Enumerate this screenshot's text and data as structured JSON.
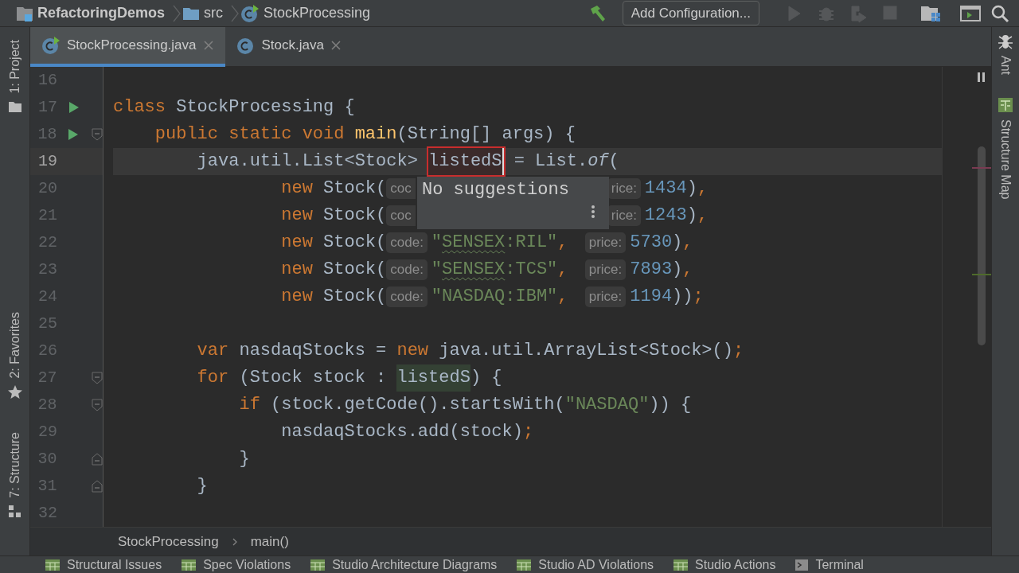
{
  "breadcrumb": [
    {
      "label": "RefactoringDemos",
      "kind": "project"
    },
    {
      "label": "src",
      "kind": "folder"
    },
    {
      "label": "StockProcessing",
      "kind": "class"
    }
  ],
  "toolbar": {
    "config_button": "Add Configuration...",
    "actions": [
      {
        "kind": "run",
        "disabled": true
      },
      {
        "kind": "debug",
        "disabled": true
      },
      {
        "kind": "coverage",
        "disabled": true
      },
      {
        "kind": "stop",
        "disabled": true
      }
    ]
  },
  "left_strip": [
    {
      "label": "1: Project",
      "kind": "project"
    },
    {
      "label": "2: Favorites",
      "kind": "favorites"
    },
    {
      "label": "7: Structure",
      "kind": "structure"
    }
  ],
  "right_strip": [
    {
      "label": "Ant",
      "kind": "ant"
    },
    {
      "label": "Structure Map",
      "kind": "map"
    }
  ],
  "tabs": [
    {
      "label": "StockProcessing.java",
      "selected": true,
      "kind": "runnable"
    },
    {
      "label": "Stock.java",
      "selected": false,
      "kind": "class"
    }
  ],
  "lines": [
    {
      "number": "16",
      "current": false
    },
    {
      "number": "17",
      "current": false,
      "run": true,
      "tokens": [
        {
          "kind": "kw",
          "text": "class"
        },
        {
          "kind": "id",
          "text": " StockProcessing {"
        }
      ]
    },
    {
      "number": "18",
      "current": false,
      "run": true,
      "fold_start": true,
      "tokens": [
        {
          "kind": "kw",
          "text": "    public static void "
        },
        {
          "kind": "fn",
          "text": "main"
        },
        {
          "kind": "id",
          "text": "(String[] args) {"
        }
      ]
    },
    {
      "number": "19",
      "current": true,
      "tokens": [
        {
          "kind": "id",
          "text": "        java.util.List<Stock> "
        },
        {
          "kind": "rename",
          "text": "listedS"
        },
        {
          "kind": "id",
          "text": " = List."
        },
        {
          "kind": "it",
          "text": "of"
        },
        {
          "kind": "id",
          "text": "("
        }
      ]
    },
    {
      "number": "20",
      "current": false,
      "tokens": [
        {
          "kind": "kw",
          "text": "                new "
        },
        {
          "kind": "id",
          "text": "Stock("
        },
        {
          "kind": "hint",
          "text": "coc",
          "cut": true
        },
        {
          "kind": "hint",
          "text": "rice:"
        },
        {
          "kind": "num",
          "text": "1434"
        },
        {
          "kind": "id",
          "text": ")"
        },
        {
          "kind": "punct",
          "text": ","
        }
      ]
    },
    {
      "number": "21",
      "current": false,
      "tokens": [
        {
          "kind": "kw",
          "text": "                new "
        },
        {
          "kind": "id",
          "text": "Stock("
        },
        {
          "kind": "hint",
          "text": "coc",
          "cut": true
        },
        {
          "kind": "hint",
          "text": "rice:"
        },
        {
          "kind": "num",
          "text": "1243"
        },
        {
          "kind": "id",
          "text": ")"
        },
        {
          "kind": "punct",
          "text": ","
        }
      ]
    },
    {
      "number": "22",
      "current": false,
      "tokens": [
        {
          "kind": "kw",
          "text": "                new "
        },
        {
          "kind": "id",
          "text": "Stock("
        },
        {
          "kind": "hint",
          "text": "code:"
        },
        {
          "kind": "str",
          "text": "\""
        },
        {
          "kind": "str",
          "text": "SENSEX",
          "typo": true
        },
        {
          "kind": "str",
          "text": ":RIL\""
        },
        {
          "kind": "punct",
          "text": ", "
        },
        {
          "kind": "hint",
          "text": "price:"
        },
        {
          "kind": "num",
          "text": "5730"
        },
        {
          "kind": "id",
          "text": ")"
        },
        {
          "kind": "punct",
          "text": ","
        }
      ]
    },
    {
      "number": "23",
      "current": false,
      "tokens": [
        {
          "kind": "kw",
          "text": "                new "
        },
        {
          "kind": "id",
          "text": "Stock("
        },
        {
          "kind": "hint",
          "text": "code:"
        },
        {
          "kind": "str",
          "text": "\""
        },
        {
          "kind": "str",
          "text": "SENSEX",
          "typo": true
        },
        {
          "kind": "str",
          "text": ":TCS\""
        },
        {
          "kind": "punct",
          "text": ", "
        },
        {
          "kind": "hint",
          "text": "price:"
        },
        {
          "kind": "num",
          "text": "7893"
        },
        {
          "kind": "id",
          "text": ")"
        },
        {
          "kind": "punct",
          "text": ","
        }
      ]
    },
    {
      "number": "24",
      "current": false,
      "tokens": [
        {
          "kind": "kw",
          "text": "                new "
        },
        {
          "kind": "id",
          "text": "Stock("
        },
        {
          "kind": "hint",
          "text": "code:"
        },
        {
          "kind": "str",
          "text": "\"NASDAQ:IBM\""
        },
        {
          "kind": "punct",
          "text": ", "
        },
        {
          "kind": "hint",
          "text": "price:"
        },
        {
          "kind": "num",
          "text": "1194"
        },
        {
          "kind": "id",
          "text": "))"
        },
        {
          "kind": "punct",
          "text": ";"
        }
      ]
    },
    {
      "number": "25",
      "current": false
    },
    {
      "number": "26",
      "current": false,
      "tokens": [
        {
          "kind": "kw",
          "text": "        var"
        },
        {
          "kind": "id",
          "text": " nasdaqStocks = "
        },
        {
          "kind": "kw",
          "text": "new"
        },
        {
          "kind": "id",
          "text": " java.util.ArrayList<Stock>()"
        },
        {
          "kind": "punct",
          "text": ";"
        }
      ]
    },
    {
      "number": "27",
      "current": false,
      "fold_start": true,
      "tokens": [
        {
          "kind": "kw",
          "text": "        for"
        },
        {
          "kind": "id",
          "text": " (Stock stock : "
        },
        {
          "kind": "usage",
          "text": "listedS"
        },
        {
          "kind": "id",
          "text": ") {"
        }
      ]
    },
    {
      "number": "28",
      "current": false,
      "fold_start": true,
      "tokens": [
        {
          "kind": "kw",
          "text": "            if"
        },
        {
          "kind": "id",
          "text": " (stock.getCode().startsWith("
        },
        {
          "kind": "str",
          "text": "\"NASDAQ\""
        },
        {
          "kind": "id",
          "text": ")) {"
        }
      ]
    },
    {
      "number": "29",
      "current": false,
      "tokens": [
        {
          "kind": "id",
          "text": "                nasdaqStocks.add(stock)"
        },
        {
          "kind": "punct",
          "text": ";"
        }
      ]
    },
    {
      "number": "30",
      "current": false,
      "fold_end": true,
      "tokens": [
        {
          "kind": "id",
          "text": "            }"
        }
      ]
    },
    {
      "number": "31",
      "current": false,
      "fold_end": true,
      "tokens": [
        {
          "kind": "id",
          "text": "        }"
        }
      ]
    },
    {
      "number": "32",
      "current": false
    }
  ],
  "popup": {
    "message": "No suggestions"
  },
  "code_breadcrumb": [
    "StockProcessing",
    "main()"
  ],
  "bottom_bar": [
    {
      "label": "Structural Issues",
      "kind": "table"
    },
    {
      "label": "Spec Violations",
      "kind": "table"
    },
    {
      "label": "Studio Architecture Diagrams",
      "kind": "table"
    },
    {
      "label": "Studio AD Violations",
      "kind": "table"
    },
    {
      "label": "Studio Actions",
      "kind": "table"
    },
    {
      "label": "Terminal",
      "kind": "terminal"
    }
  ]
}
